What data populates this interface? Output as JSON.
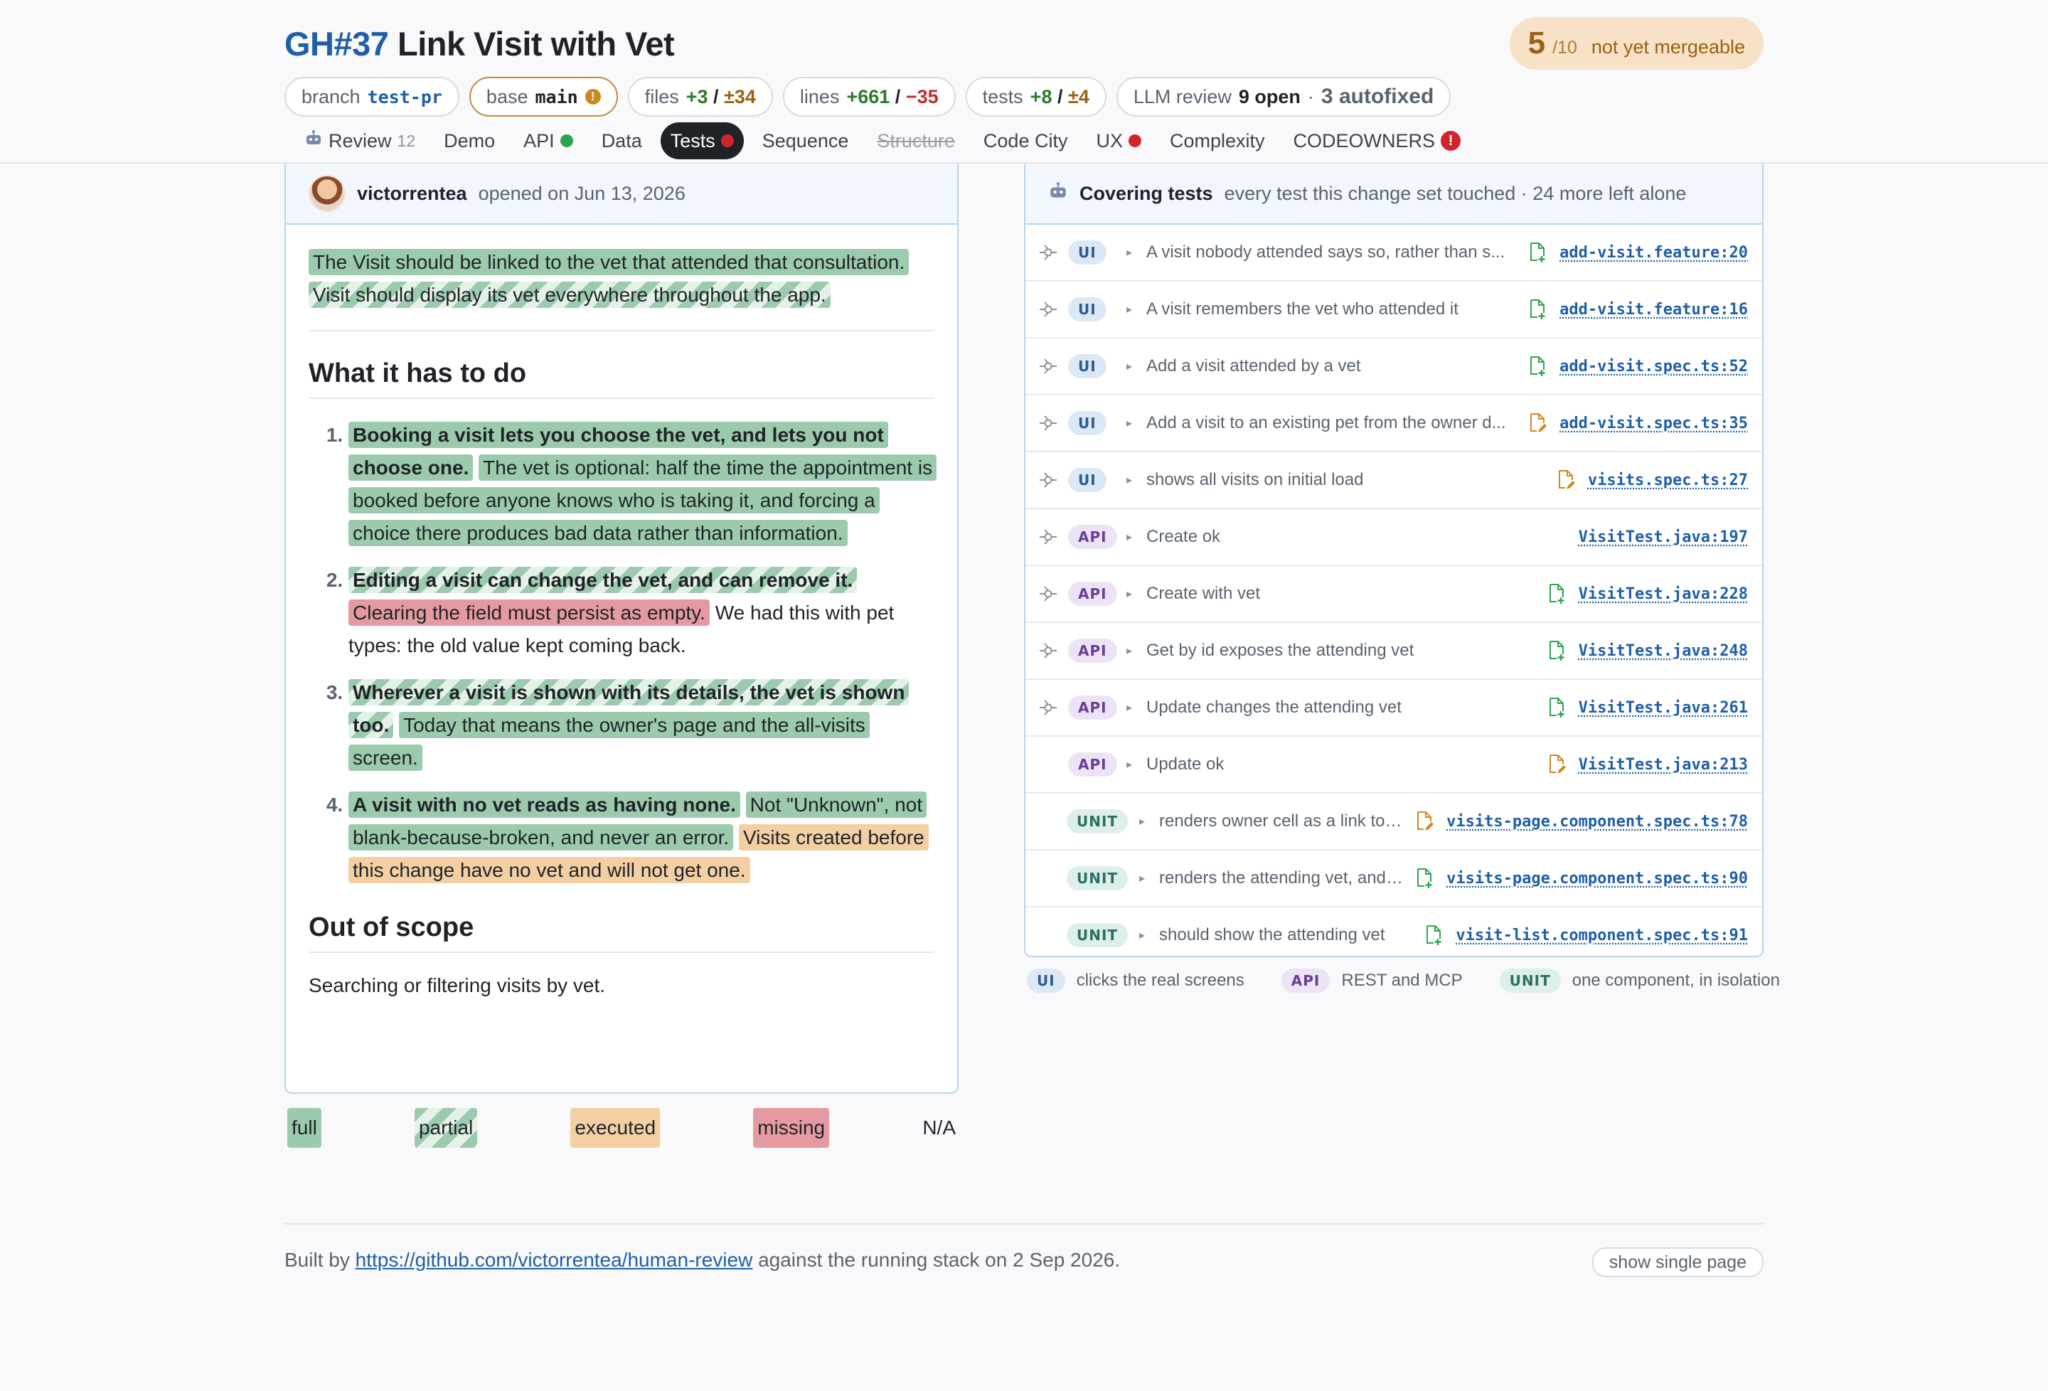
{
  "header": {
    "issue": "GH#37",
    "title": "Link Visit with Vet",
    "score": {
      "value": "5",
      "of": "/10",
      "label": "not yet mergeable"
    }
  },
  "pills": {
    "branch": {
      "label": "branch",
      "value": "test-pr"
    },
    "base": {
      "label": "base",
      "value": "main",
      "warn": "!"
    },
    "files": {
      "label": "files",
      "added": "+3",
      "sep": "/",
      "changed": "±34"
    },
    "lines": {
      "label": "lines",
      "added": "+661",
      "sep": "/",
      "removed": "−35"
    },
    "tests": {
      "label": "tests",
      "added": "+8",
      "sep": "/",
      "changed": "±4"
    },
    "llm": {
      "label": "LLM review",
      "open": "9 open",
      "dot": "·",
      "fixed": "3 autofixed"
    }
  },
  "tabs": [
    {
      "label": "Review",
      "count": "12"
    },
    {
      "label": "Demo"
    },
    {
      "label": "API"
    },
    {
      "label": "Data"
    },
    {
      "label": "Tests"
    },
    {
      "label": "Sequence"
    },
    {
      "label": "Structure"
    },
    {
      "label": "Code City"
    },
    {
      "label": "UX"
    },
    {
      "label": "Complexity"
    },
    {
      "label": "CODEOWNERS",
      "badge": "!"
    }
  ],
  "story": {
    "author": "victorrentea",
    "opened": "opened on Jun 13, 2026",
    "intro_1": "The Visit should be linked to the vet that attended that consultation.",
    "intro_2": "Visit should display its vet everywhere throughout the app.",
    "todo_heading": "What it has to do",
    "items": [
      {
        "bold": "Booking a visit lets you choose the vet, and lets you not choose one.",
        "text": "The vet is optional: half the time the appointment is booked before anyone knows who is taking it, and forcing a choice there produces bad data rather than information."
      },
      {
        "bold": "Editing a visit can change the vet, and can remove it.",
        "text": "Clearing the field must persist as empty.",
        "tail": "We had this with pet types: the old value kept coming back."
      },
      {
        "bold": "Wherever a visit is shown with its details, the vet is shown too.",
        "text": "Today that means the owner's page and the all-visits screen."
      },
      {
        "bold": "A visit with no vet reads as having none.",
        "text": "Not \"Unknown\", not blank-because-broken, and never an error.",
        "tail": "Visits created before this change have no vet and will not get one."
      }
    ],
    "scope_heading": "Out of scope",
    "scope_text": "Searching or filtering visits by vet."
  },
  "legend": {
    "full": "full",
    "partial": "partial",
    "executed": "executed",
    "missing": "missing",
    "na": "N/A"
  },
  "covering": {
    "title": "Covering tests",
    "subtitle": "every test this change set touched · 24 more left alone",
    "rows": [
      {
        "kind": "UI",
        "desc": "A visit nobody attended says so, rather than s...",
        "file": "add-visit.feature:20",
        "icon": "file-added-icon",
        "color": "#2da44e"
      },
      {
        "kind": "UI",
        "desc": "A visit remembers the vet who attended it",
        "file": "add-visit.feature:16",
        "icon": "file-added-icon",
        "color": "#2da44e"
      },
      {
        "kind": "UI",
        "desc": "Add a visit attended by a vet",
        "file": "add-visit.spec.ts:52",
        "icon": "file-added-icon",
        "color": "#2da44e"
      },
      {
        "kind": "UI",
        "desc": "Add a visit to an existing pet from the owner d...",
        "file": "add-visit.spec.ts:35",
        "icon": "file-edited-icon",
        "color": "#d4871e"
      },
      {
        "kind": "UI",
        "desc": "shows all visits on initial load",
        "file": "visits.spec.ts:27",
        "icon": "file-edited-icon",
        "color": "#d4871e"
      },
      {
        "kind": "API",
        "desc": "Create ok",
        "file": "VisitTest.java:197",
        "icon": "",
        "color": ""
      },
      {
        "kind": "API",
        "desc": "Create with vet",
        "file": "VisitTest.java:228",
        "icon": "file-added-icon",
        "color": "#2da44e"
      },
      {
        "kind": "API",
        "desc": "Get by id exposes the attending vet",
        "file": "VisitTest.java:248",
        "icon": "file-added-icon",
        "color": "#2da44e"
      },
      {
        "kind": "API",
        "desc": "Update changes the attending vet",
        "file": "VisitTest.java:261",
        "icon": "file-added-icon",
        "color": "#2da44e"
      },
      {
        "kind": "API",
        "desc": "Update ok",
        "file": "VisitTest.java:213",
        "icon": "file-edited-icon",
        "color": "#d4871e"
      },
      {
        "kind": "UNIT",
        "desc": "renders owner cell as a link to /...",
        "file": "visits-page.component.spec.ts:78",
        "icon": "file-edited-icon",
        "color": "#d4871e"
      },
      {
        "kind": "UNIT",
        "desc": "renders the attending vet, and ...",
        "file": "visits-page.component.spec.ts:90",
        "icon": "file-added-icon",
        "color": "#2da44e"
      },
      {
        "kind": "UNIT",
        "desc": "should show the attending vet",
        "file": "visit-list.component.spec.ts:91",
        "icon": "file-added-icon",
        "color": "#2da44e"
      }
    ],
    "legend": [
      {
        "kind": "UI",
        "text": "clicks the real screens"
      },
      {
        "kind": "API",
        "text": "REST and MCP"
      },
      {
        "kind": "UNIT",
        "text": "one component, in isolation"
      }
    ]
  },
  "footer": {
    "prefix": "Built by",
    "link": "https://github.com/victorrentea/human-review",
    "suffix": "against the running stack on 2 Sep 2026.",
    "single_page": "show single page"
  }
}
